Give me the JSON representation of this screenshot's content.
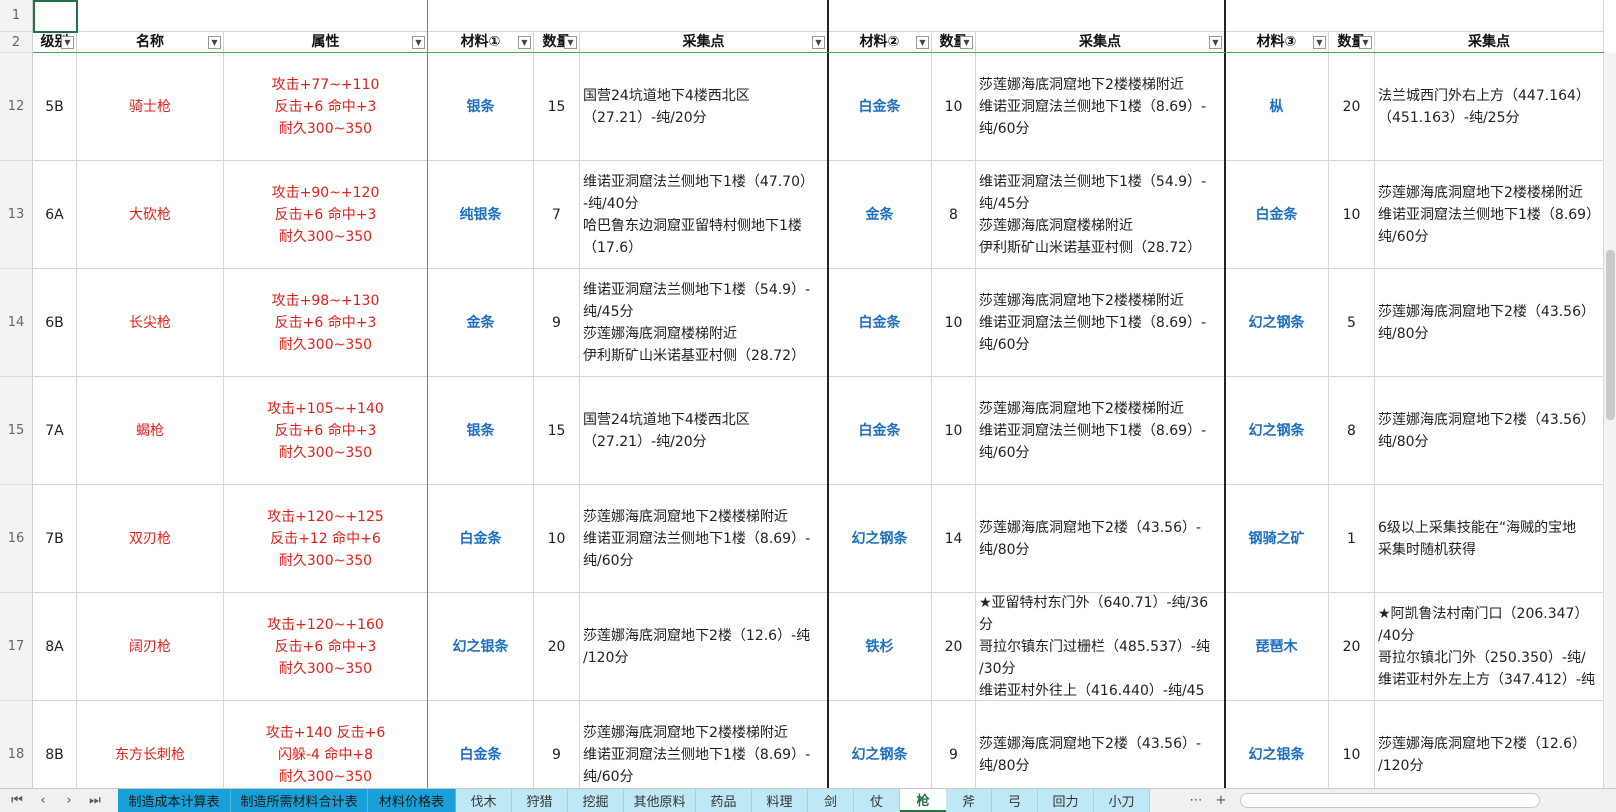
{
  "columns": [
    {
      "key": "level",
      "header": "级别",
      "filter": true
    },
    {
      "key": "name",
      "header": "名称",
      "filter": true
    },
    {
      "key": "attr",
      "header": "属性",
      "filter": true
    },
    {
      "key": "mat1",
      "header": "材料①",
      "filter": true
    },
    {
      "key": "qty1",
      "header": "数量",
      "filter": true
    },
    {
      "key": "loc1",
      "header": "采集点",
      "filter": true
    },
    {
      "key": "mat2",
      "header": "材料②",
      "filter": true
    },
    {
      "key": "qty2",
      "header": "数量",
      "filter": true
    },
    {
      "key": "loc2",
      "header": "采集点",
      "filter": true
    },
    {
      "key": "mat3",
      "header": "材料③",
      "filter": true
    },
    {
      "key": "qty3",
      "header": "数量",
      "filter": true
    },
    {
      "key": "loc3",
      "header": "采集点",
      "filter": false
    }
  ],
  "top_row_numbers": [
    "1",
    "2"
  ],
  "rows": [
    {
      "num": "12",
      "level": "5B",
      "name": "骑士枪",
      "attr": "攻击+77~+110\n反击+6 命中+3\n耐久300~350",
      "mat1": "银条",
      "qty1": "15",
      "loc1": "国营24坑道地下4楼西北区\n（27.21）-纯/20分",
      "mat2": "白金条",
      "qty2": "10",
      "loc2": "莎莲娜海底洞窟地下2楼楼梯附近\n维诺亚洞窟法兰侧地下1楼（8.69）-\n纯/60分",
      "mat3": "枞",
      "qty3": "20",
      "loc3": "法兰城西门外右上方（447.164）\n（451.163）-纯/25分"
    },
    {
      "num": "13",
      "level": "6A",
      "name": "大砍枪",
      "attr": "攻击+90~+120\n反击+6 命中+3\n耐久300~350",
      "mat1": "纯银条",
      "qty1": "7",
      "loc1": "维诺亚洞窟法兰侧地下1楼（47.70）\n-纯/40分\n哈巴鲁东边洞窟亚留特村侧地下1楼\n（17.6）",
      "mat2": "金条",
      "qty2": "8",
      "loc2": "维诺亚洞窟法兰侧地下1楼（54.9）-\n纯/45分\n莎莲娜海底洞窟楼梯附近\n伊利斯矿山米诺基亚村侧（28.72）",
      "mat3": "白金条",
      "qty3": "10",
      "loc3": "莎莲娜海底洞窟地下2楼楼梯附近\n维诺亚洞窟法兰侧地下1楼（8.69）\n纯/60分"
    },
    {
      "num": "14",
      "level": "6B",
      "name": "长尖枪",
      "attr": "攻击+98~+130\n反击+6 命中+3\n耐久300~350",
      "mat1": "金条",
      "qty1": "9",
      "loc1": "维诺亚洞窟法兰侧地下1楼（54.9）-\n纯/45分\n莎莲娜海底洞窟楼梯附近\n伊利斯矿山米诺基亚村侧（28.72）",
      "mat2": "白金条",
      "qty2": "10",
      "loc2": "莎莲娜海底洞窟地下2楼楼梯附近\n维诺亚洞窟法兰侧地下1楼（8.69）-\n纯/60分",
      "mat3": "幻之钢条",
      "qty3": "5",
      "loc3": "莎莲娜海底洞窟地下2楼（43.56）\n纯/80分"
    },
    {
      "num": "15",
      "level": "7A",
      "name": "蝎枪",
      "attr": "攻击+105~+140\n反击+6 命中+3\n耐久300~350",
      "mat1": "银条",
      "qty1": "15",
      "loc1": "国营24坑道地下4楼西北区\n（27.21）-纯/20分",
      "mat2": "白金条",
      "qty2": "10",
      "loc2": "莎莲娜海底洞窟地下2楼楼梯附近\n维诺亚洞窟法兰侧地下1楼（8.69）-\n纯/60分",
      "mat3": "幻之钢条",
      "qty3": "8",
      "loc3": "莎莲娜海底洞窟地下2楼（43.56）\n纯/80分"
    },
    {
      "num": "16",
      "level": "7B",
      "name": "双刃枪",
      "attr": "攻击+120~+125\n反击+12 命中+6\n耐久300~350",
      "mat1": "白金条",
      "qty1": "10",
      "loc1": "莎莲娜海底洞窟地下2楼楼梯附近\n维诺亚洞窟法兰侧地下1楼（8.69）-\n纯/60分",
      "mat2": "幻之钢条",
      "qty2": "14",
      "loc2": "莎莲娜海底洞窟地下2楼（43.56）-\n纯/80分",
      "mat3": "钢骑之矿",
      "qty3": "1",
      "loc3": "6级以上采集技能在“海贼的宝地\n采集时随机获得"
    },
    {
      "num": "17",
      "level": "8A",
      "name": "阔刃枪",
      "attr": "攻击+120~+160\n反击+6 命中+3\n耐久300~350",
      "mat1": "幻之银条",
      "qty1": "20",
      "loc1": "莎莲娜海底洞窟地下2楼（12.6）-纯\n/120分",
      "mat2": "铁杉",
      "qty2": "20",
      "loc2": "★亚留特村东门外（640.71）-纯/36\n分\n哥拉尔镇东门过栅栏（485.537）-纯\n/30分\n维诺亚村外往上（416.440）-纯/45",
      "mat3": "琵琶木",
      "qty3": "20",
      "loc3": "★阿凯鲁法村南门口（206.347）\n/40分\n哥拉尔镇北门外（250.350）-纯/\n维诺亚村外左上方（347.412）-纯"
    },
    {
      "num": "18",
      "level": "8B",
      "name": "东方长刺枪",
      "attr": "攻击+140 反击+6\n闪躲-4 命中+8\n耐久300~350",
      "mat1": "白金条",
      "qty1": "9",
      "loc1": "莎莲娜海底洞窟地下2楼楼梯附近\n维诺亚洞窟法兰侧地下1楼（8.69）-\n纯/60分",
      "mat2": "幻之钢条",
      "qty2": "9",
      "loc2": "莎莲娜海底洞窟地下2楼（43.56）-\n纯/80分",
      "mat3": "幻之银条",
      "qty3": "10",
      "loc3": "莎莲娜海底洞窟地下2楼（12.6）\n/120分"
    }
  ],
  "sheet_tabs": [
    {
      "label": "制造成本计算表",
      "style": "colored"
    },
    {
      "label": "制造所需材料合计表",
      "style": "colored"
    },
    {
      "label": "材料价格表",
      "style": "colored"
    },
    {
      "label": "伐木",
      "style": "plain"
    },
    {
      "label": "狩猎",
      "style": "plain"
    },
    {
      "label": "挖掘",
      "style": "plain"
    },
    {
      "label": "其他原料",
      "style": "plain"
    },
    {
      "label": "药品",
      "style": "plain"
    },
    {
      "label": "料理",
      "style": "plain"
    },
    {
      "label": "剑",
      "style": "plain"
    },
    {
      "label": "仗",
      "style": "plain"
    },
    {
      "label": "枪",
      "style": "active"
    },
    {
      "label": "斧",
      "style": "plain"
    },
    {
      "label": "弓",
      "style": "plain"
    },
    {
      "label": "回力",
      "style": "plain"
    },
    {
      "label": "小刀",
      "style": "plain"
    }
  ],
  "nav": {
    "first": "⏮",
    "prev": "‹",
    "next": "›",
    "last": "⏭",
    "more": "⋯",
    "add": "+"
  }
}
